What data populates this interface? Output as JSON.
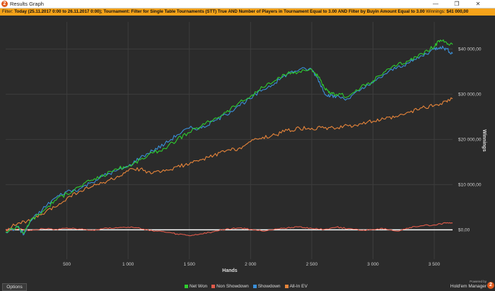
{
  "window": {
    "title": "Results Graph",
    "app_icon": "hm2-logo-icon",
    "buttons": {
      "minimize": "—",
      "restore": "❐",
      "close": "✕"
    }
  },
  "filter": {
    "label": "Filter:",
    "text": "Today (25.11.2017 0:00 to 26.11.2017 0:00); Tournament: Filter for Single Table Tournaments (STT) True AND Number of Players in Tournament Equal to 3.00 AND Filter by Buyin Amount Equal to 3.00",
    "winnings_label": "Winnings:",
    "winnings_value": "$41 000,00"
  },
  "footer": {
    "options_label": "Options",
    "brand_small": "Powered by",
    "brand_name": "Hold'em Manager",
    "brand_icon": "hm2-logo-icon"
  },
  "chart_data": {
    "type": "line",
    "xlabel": "Hands",
    "ylabel": "Winnings",
    "xlim": [
      0,
      3650
    ],
    "ylim": [
      -6500,
      46000
    ],
    "x_ticks": [
      500,
      1000,
      1500,
      2000,
      2500,
      3000,
      3500
    ],
    "x_tick_labels": [
      "500",
      "1 000",
      "1 500",
      "2 000",
      "2 500",
      "3 000",
      "3 500"
    ],
    "y_ticks": [
      0,
      10000,
      20000,
      30000,
      40000
    ],
    "y_tick_labels": [
      "$0,00",
      "$10 000,00",
      "$20 000,00",
      "$30 000,00",
      "$40 000,00"
    ],
    "grid": true,
    "legend_position": "bottom",
    "colors": {
      "background": "#2b2b2b",
      "grid": "#3d3d3d",
      "zero_line": "#ffffff"
    },
    "series": [
      {
        "name": "Net Won",
        "color": "#2ecc2e",
        "x": [
          0,
          100,
          150,
          200,
          300,
          400,
          500,
          600,
          700,
          800,
          900,
          1000,
          1100,
          1200,
          1300,
          1400,
          1500,
          1600,
          1700,
          1800,
          1900,
          2000,
          2100,
          2200,
          2300,
          2400,
          2500,
          2550,
          2600,
          2650,
          2700,
          2800,
          2900,
          3000,
          3100,
          3200,
          3300,
          3400,
          3500,
          3550,
          3600,
          3650
        ],
        "y": [
          -500,
          800,
          -800,
          2000,
          4000,
          6500,
          8000,
          9500,
          11000,
          12000,
          13500,
          14000,
          15500,
          17000,
          18000,
          20000,
          21500,
          23000,
          24500,
          26000,
          28000,
          29500,
          31500,
          33000,
          34500,
          35000,
          35500,
          34000,
          31500,
          30000,
          30000,
          29500,
          31500,
          33000,
          35000,
          36500,
          37500,
          39000,
          40500,
          42000,
          41500,
          41000
        ]
      },
      {
        "name": "Non Showdown",
        "color": "#e05a4a",
        "x": [
          0,
          100,
          200,
          300,
          400,
          500,
          600,
          700,
          800,
          900,
          1000,
          1100,
          1200,
          1300,
          1400,
          1500,
          1600,
          1700,
          1800,
          1900,
          2000,
          2100,
          2200,
          2300,
          2400,
          2500,
          2600,
          2700,
          2800,
          2900,
          3000,
          3100,
          3200,
          3300,
          3400,
          3500,
          3600,
          3650
        ],
        "y": [
          0,
          200,
          -100,
          300,
          100,
          400,
          200,
          -100,
          300,
          500,
          600,
          300,
          -200,
          -500,
          -900,
          -1300,
          -900,
          -400,
          200,
          400,
          100,
          -300,
          200,
          400,
          700,
          300,
          100,
          600,
          300,
          -100,
          100,
          300,
          -300,
          500,
          900,
          1100,
          1500,
          1500
        ]
      },
      {
        "name": "Showdown",
        "color": "#3a8fd9",
        "x": [
          0,
          100,
          150,
          200,
          300,
          400,
          500,
          600,
          700,
          800,
          900,
          1000,
          1100,
          1200,
          1300,
          1400,
          1500,
          1600,
          1700,
          1800,
          1900,
          2000,
          2100,
          2200,
          2300,
          2400,
          2500,
          2550,
          2600,
          2650,
          2700,
          2800,
          2900,
          3000,
          3100,
          3200,
          3300,
          3400,
          3500,
          3550,
          3600,
          3650
        ],
        "y": [
          -500,
          600,
          -1000,
          1800,
          4500,
          7000,
          8500,
          9000,
          10500,
          12000,
          13000,
          14000,
          16000,
          17500,
          19000,
          21000,
          22500,
          22500,
          24000,
          25500,
          27500,
          29000,
          31000,
          32500,
          34500,
          35500,
          35500,
          33500,
          30500,
          29500,
          29500,
          29000,
          31000,
          32500,
          34500,
          36000,
          37000,
          38500,
          40000,
          40500,
          40000,
          39000
        ]
      },
      {
        "name": "All-In EV",
        "color": "#e8853a",
        "x": [
          0,
          100,
          200,
          300,
          400,
          500,
          600,
          700,
          800,
          900,
          1000,
          1100,
          1200,
          1300,
          1400,
          1500,
          1600,
          1700,
          1800,
          1900,
          2000,
          2100,
          2200,
          2300,
          2400,
          2500,
          2600,
          2700,
          2800,
          2900,
          3000,
          3100,
          3200,
          3300,
          3400,
          3500,
          3600,
          3650
        ],
        "y": [
          0,
          1500,
          2000,
          3500,
          5000,
          7000,
          8500,
          9500,
          10500,
          11500,
          13000,
          13500,
          12500,
          13000,
          14000,
          14500,
          15500,
          16500,
          17500,
          18000,
          19500,
          20500,
          21000,
          22000,
          22500,
          22500,
          22500,
          22500,
          23000,
          23500,
          24000,
          24500,
          25000,
          26000,
          27000,
          27500,
          28500,
          29000
        ]
      }
    ]
  }
}
